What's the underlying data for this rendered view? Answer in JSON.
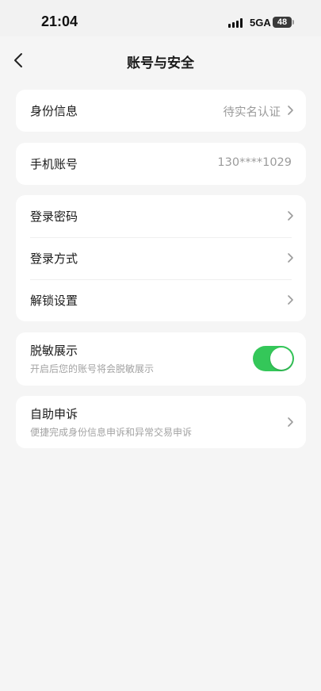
{
  "status_bar": {
    "time": "21:04",
    "network": "5GA",
    "battery": "48"
  },
  "nav": {
    "title": "账号与安全",
    "back_icon": "chevron-left-icon"
  },
  "identity": {
    "label": "身份信息",
    "value": "待实名认证"
  },
  "phone": {
    "label": "手机账号",
    "value": "130****1029"
  },
  "security": {
    "items": [
      {
        "label": "登录密码"
      },
      {
        "label": "登录方式"
      },
      {
        "label": "解锁设置"
      }
    ]
  },
  "desensitize": {
    "label": "脱敏展示",
    "description": "开启后您的账号将会脱敏展示",
    "enabled": true
  },
  "appeal": {
    "label": "自助申诉",
    "description": "便捷完成身份信息申诉和异常交易申诉"
  },
  "colors": {
    "toggle_on": "#34c759",
    "background": "#f5f5f5",
    "card": "#ffffff"
  }
}
